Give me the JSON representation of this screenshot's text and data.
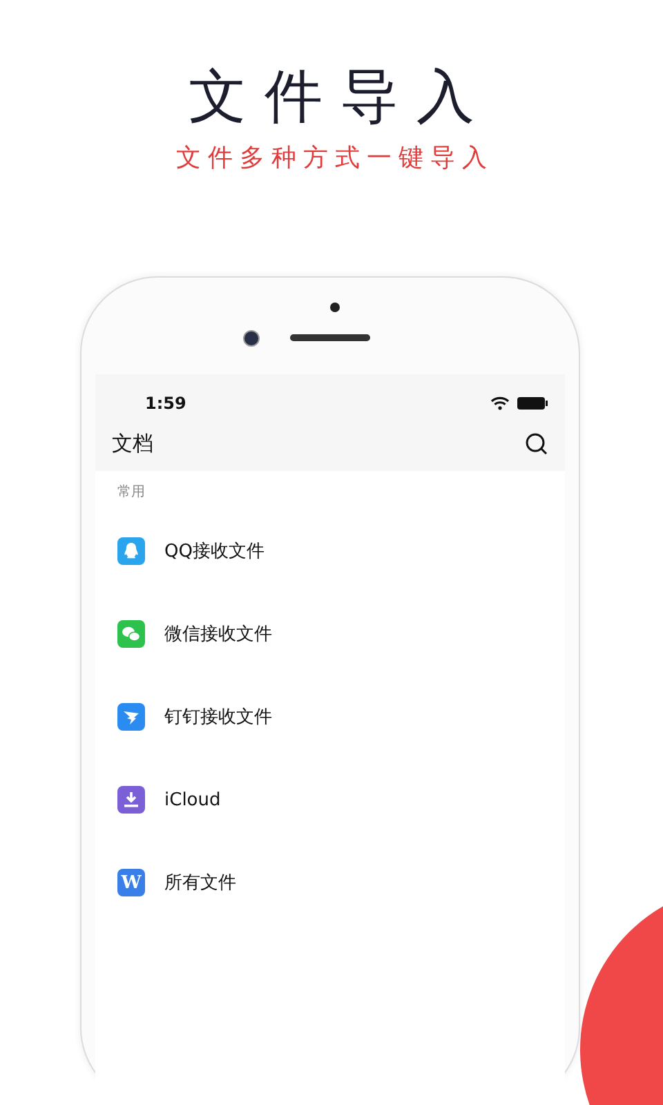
{
  "headline": {
    "title": "文件导入",
    "subtitle": "文件多种方式一键导入"
  },
  "phone": {
    "status_bar": {
      "time": "1:59"
    },
    "nav": {
      "title": "文档"
    },
    "section": "常用",
    "items": [
      {
        "label": "QQ接收文件",
        "kind": "qq"
      },
      {
        "label": "微信接收文件",
        "kind": "wechat"
      },
      {
        "label": "钉钉接收文件",
        "kind": "dingtalk"
      },
      {
        "label": "iCloud",
        "kind": "download"
      },
      {
        "label": "所有文件",
        "kind": "letter",
        "glyph": "W"
      }
    ]
  }
}
